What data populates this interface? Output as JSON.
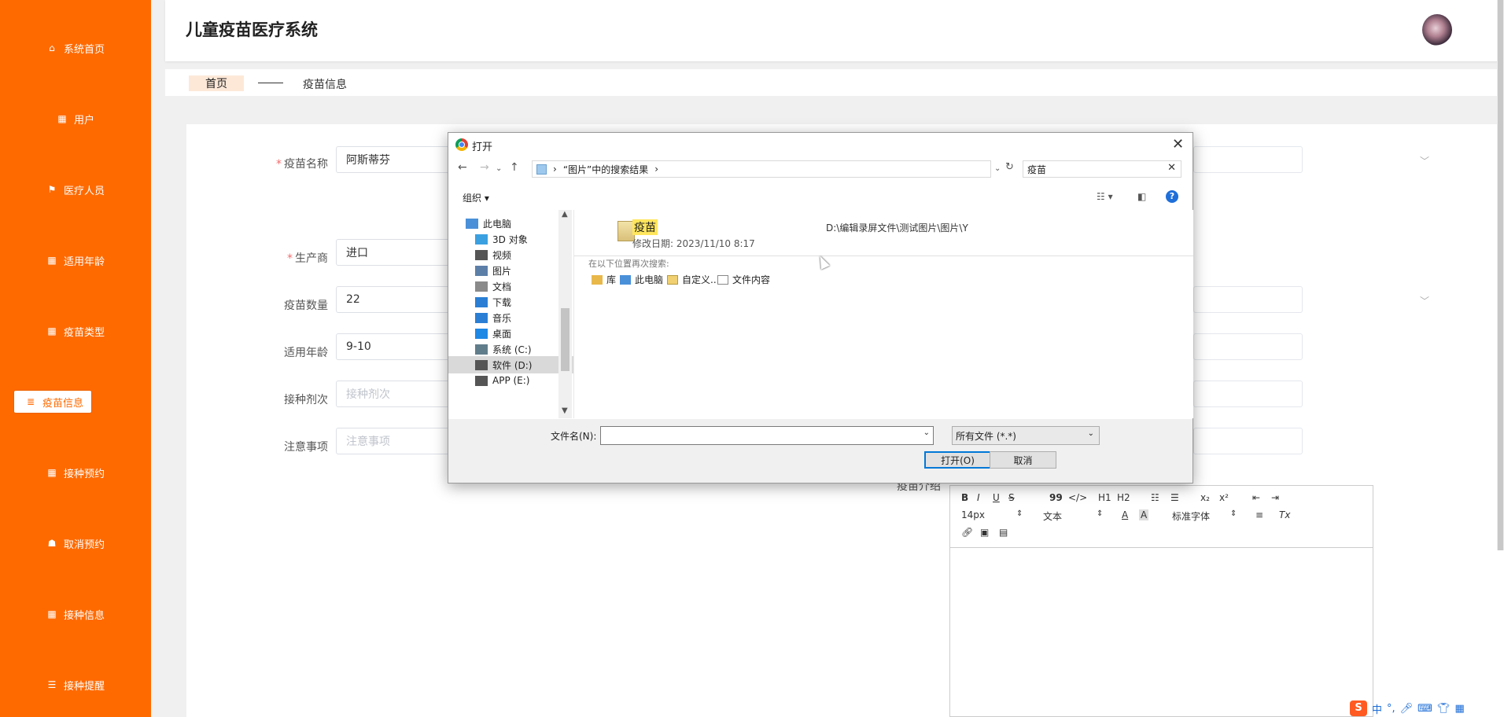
{
  "sidebar": {
    "items": [
      {
        "label": "系统首页",
        "icon": "home-icon"
      },
      {
        "label": "用户",
        "icon": "grid-icon"
      },
      {
        "label": "医疗人员",
        "icon": "flag-icon"
      },
      {
        "label": "适用年龄",
        "icon": "grid-icon"
      },
      {
        "label": "疫苗类型",
        "icon": "grid-icon"
      },
      {
        "label": "疫苗信息",
        "icon": "stack-icon"
      },
      {
        "label": "接种预约",
        "icon": "grid-icon"
      },
      {
        "label": "取消预约",
        "icon": "thumb-icon"
      },
      {
        "label": "接种信息",
        "icon": "grid-icon"
      },
      {
        "label": "接种提醒",
        "icon": "sliders-icon"
      }
    ],
    "active_index": 5
  },
  "header": {
    "title": "儿童疫苗医疗系统"
  },
  "breadcrumb": {
    "home": "首页",
    "current": "疫苗信息"
  },
  "form": {
    "vaccine_name": {
      "label": "疫苗名称",
      "value": "阿斯蒂芬"
    },
    "manufacturer": {
      "label": "生产商",
      "value": "进口"
    },
    "quantity": {
      "label": "疫苗数量",
      "value": "22"
    },
    "age": {
      "label": "适用年龄",
      "value": "9-10"
    },
    "dose": {
      "label": "接种剂次",
      "placeholder": "接种剂次"
    },
    "notes": {
      "label": "注意事项",
      "placeholder": "注意事项"
    },
    "intro": {
      "label": "疫苗介绍"
    }
  },
  "editor": {
    "font_size": "14px",
    "text_type": "文本",
    "font_family": "标准字体",
    "b": "B",
    "i": "I",
    "u": "U",
    "s": "S",
    "quote": "99",
    "code": "</>",
    "h1": "H1",
    "h2": "H2",
    "sub": "x₂",
    "sup": "x²",
    "color_a": "A",
    "bg_a": "A",
    "clear": "Tx"
  },
  "dialog": {
    "title": "打开",
    "address": "“图片”中的搜索结果",
    "search_value": "疫苗",
    "organize": "组织",
    "tree": [
      {
        "label": "此电脑",
        "color": "#4a90d9"
      },
      {
        "label": "3D 对象",
        "color": "#3aa0e0"
      },
      {
        "label": "视频",
        "color": "#555555"
      },
      {
        "label": "图片",
        "color": "#5c7fa8"
      },
      {
        "label": "文档",
        "color": "#8a8a8a"
      },
      {
        "label": "下载",
        "color": "#2a7fd4"
      },
      {
        "label": "音乐",
        "color": "#2a7fd4"
      },
      {
        "label": "桌面",
        "color": "#1e88e5"
      },
      {
        "label": "系统 (C:)",
        "color": "#607d8b"
      },
      {
        "label": "软件 (D:)",
        "color": "#555555"
      },
      {
        "label": "APP (E:)",
        "color": "#555555"
      }
    ],
    "tree_selected": 9,
    "file": {
      "name": "疫苗",
      "date": "修改日期: 2023/11/10 8:17",
      "path": "D:\\编辑录屏文件\\测试图片\\图片\\Y"
    },
    "research_label": "在以下位置再次搜索:",
    "locations": [
      "库",
      "此电脑",
      "自定义...",
      "文件内容"
    ],
    "filename_label": "文件名(N):",
    "filetype": "所有文件 (*.*)",
    "open_button": "打开(O)",
    "cancel_button": "取消"
  },
  "ime": {
    "logo": "S",
    "lang": "中",
    "punct": "°,"
  }
}
